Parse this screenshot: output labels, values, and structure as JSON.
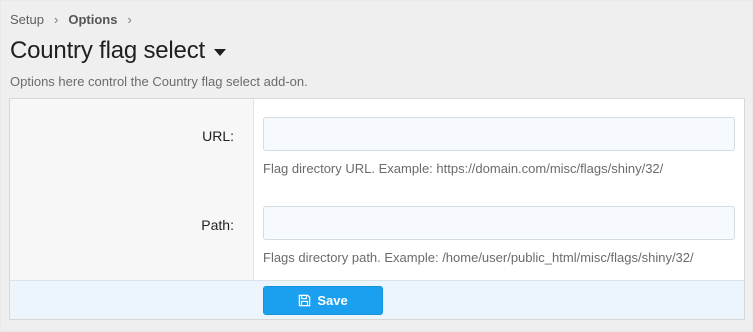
{
  "breadcrumb": {
    "items": [
      "Setup",
      "Options"
    ],
    "separator": "›"
  },
  "header": {
    "title": "Country flag select",
    "description": "Options here control the Country flag select add-on."
  },
  "form": {
    "fields": [
      {
        "label": "URL:",
        "value": "",
        "placeholder": "",
        "hint": "Flag directory URL. Example: https://domain.com/misc/flags/shiny/32/"
      },
      {
        "label": "Path:",
        "value": "",
        "placeholder": "",
        "hint": "Flags directory path. Example: /home/user/public_html/misc/flags/shiny/32/"
      }
    ],
    "save_label": "Save"
  },
  "icons": {
    "save": "floppy-disk-icon",
    "title_menu": "caret-down-icon"
  },
  "colors": {
    "accent": "#1aa0ee",
    "page_background": "#efefef",
    "submit_row_background": "#edf5fc",
    "input_background": "#f6fafe"
  }
}
